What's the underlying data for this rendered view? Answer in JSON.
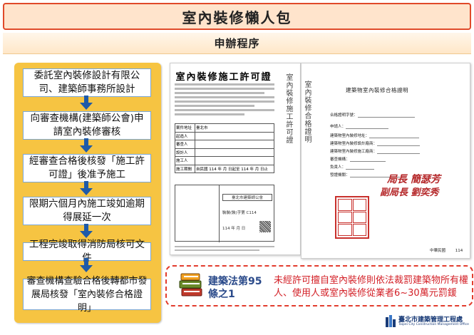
{
  "header": {
    "title": "室內裝修懶人包",
    "subtitle": "申辦程序"
  },
  "flow": {
    "steps": [
      "委託室內裝修設計有限公司、建築師事務所設計",
      "向審查機構(建築師公會)申請室內裝修審核",
      "經審查合格後核發「施工許可證」後准予施工",
      "限期六個月內施工竣如逾期得展延一次",
      "工程完竣取得消防局核可文件",
      "審查機構查驗合格後轉都市發展局核發「室內裝修合格證明」"
    ]
  },
  "permit_doc": {
    "title": "室內裝修施工許可證",
    "rows": [
      {
        "k": "案件地址",
        "v": "臺北市"
      },
      {
        "k": "起造人",
        "v": ""
      },
      {
        "k": "審查人",
        "v": ""
      },
      {
        "k": "設計人",
        "v": ""
      },
      {
        "k": "施工人",
        "v": ""
      },
      {
        "k": "施工期間",
        "v": "自民國 114 年 月 日起至 114 年 月 日止"
      }
    ],
    "office": "臺北市建築師公會",
    "number": "裝裝(裝)字第 C114",
    "date": "114 年 月 日",
    "vertical_text": [
      "室內裝修施工許可證",
      "室內裝修合格證明"
    ]
  },
  "cert_doc": {
    "title": "建築物室內裝修合格證明",
    "fields": [
      "合格證明字號：",
      "申請人：",
      "建築物室內裝修地址：",
      "建築物室內裝修設計廠商：",
      "建築物室內裝修施工廠商：",
      "審查機構：",
      "負責人：",
      "發證機關："
    ],
    "signature_1": "局長 簡瑟芳",
    "signature_2": "副局長 劉奕秀",
    "date_label": "中華民國",
    "date_year": "114"
  },
  "law": {
    "title": "建築法第95條之1",
    "text": "未經許可擅自室內裝修則依法裁罰建築物所有權人、使用人或室內裝修從業者6~30萬元罰鍰"
  },
  "footer": {
    "org": "臺北市建築管理工程處",
    "org_en": "Taipei City Construction Management Office"
  },
  "colors": {
    "accent_red": "#e04a2a",
    "flow_yellow": "#f6c442",
    "step_border": "#7aa7d8",
    "arrow_blue": "#1e5aa8",
    "law_red": "#d32027"
  }
}
